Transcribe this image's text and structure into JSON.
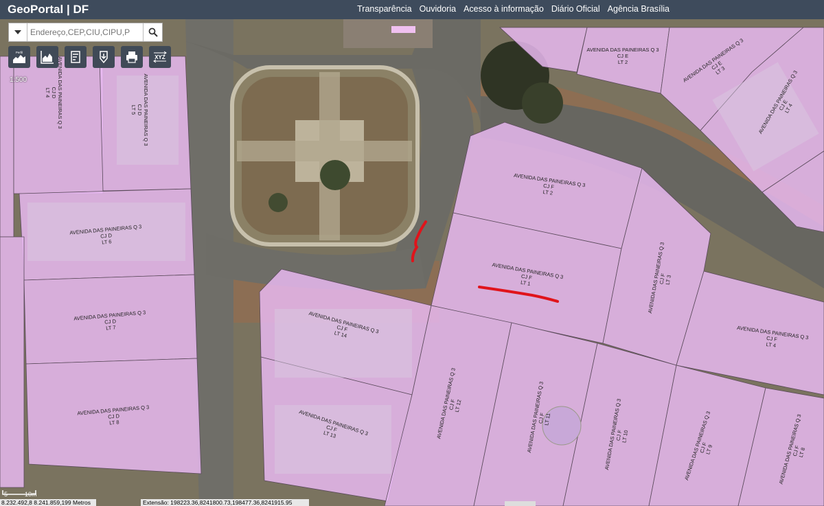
{
  "header": {
    "brand": "GeoPortal | DF",
    "nav": [
      "Transparência",
      "Ouvidoria",
      "Acesso à informação",
      "Diário Oficial",
      "Agência Brasília"
    ]
  },
  "search": {
    "placeholder": "Endereço,CEP,CIU,CIPU,P"
  },
  "toolbar": {
    "tools": [
      "profile-tool-icon",
      "elevation-chart-icon",
      "measure-tool-icon",
      "download-icon",
      "print-icon",
      "xyz-coordinates-icon"
    ],
    "profile_text": "Perfil",
    "xyz_text": "XYZ"
  },
  "map": {
    "scale": "1:500",
    "scalebar_left": "5",
    "scalebar_right": "10m",
    "coordinates": "8.232.492,8 8.241.859,199 Metros",
    "extent": "Extensão: 198223.36,8241800.73,198477.36,8241915.95",
    "lot_color": "#e7b7ef",
    "annotation_color": "#e0141b",
    "lots": [
      {
        "street": "AVENIDA DAS PAINEIRAS Q 3",
        "block": "CJ D",
        "lot": "LT 4"
      },
      {
        "street": "AVENIDA DAS PAINEIRAS Q 3",
        "block": "CJ D",
        "lot": "LT 5"
      },
      {
        "street": "AVENIDA DAS PAINEIRAS Q 3",
        "block": "CJ D",
        "lot": "LT 6"
      },
      {
        "street": "AVENIDA DAS PAINEIRAS Q 3",
        "block": "CJ D",
        "lot": "LT 7"
      },
      {
        "street": "AVENIDA DAS PAINEIRAS Q 3",
        "block": "CJ D",
        "lot": "LT 8"
      },
      {
        "street": "AVENIDA DAS PAINEIRAS Q 3",
        "block": "CJ E",
        "lot": "LT 2"
      },
      {
        "street": "AVENIDA DAS PAINEIRAS Q 3",
        "block": "CJ E",
        "lot": "LT 3"
      },
      {
        "street": "AVENIDA DAS PAINEIRAS Q 3",
        "block": "CJ E",
        "lot": "LT 4"
      },
      {
        "street": "AVENIDA DAS PAINEIRAS Q 3",
        "block": "CJ F",
        "lot": "LT 2"
      },
      {
        "street": "AVENIDA DAS PAINEIRAS Q 3",
        "block": "CJ F",
        "lot": "LT 1"
      },
      {
        "street": "AVENIDA DAS PAINEIRAS Q 3",
        "block": "CJ F",
        "lot": "LT 3"
      },
      {
        "street": "AVENIDA DAS PAINEIRAS Q 3",
        "block": "CJ F",
        "lot": "LT 4"
      },
      {
        "street": "AVENIDA DAS PAINEIRAS Q 3",
        "block": "CJ F",
        "lot": "LT 14"
      },
      {
        "street": "AVENIDA DAS PAINEIRAS Q 3",
        "block": "CJ F",
        "lot": "LT 13"
      },
      {
        "street": "AVENIDA DAS PAINEIRAS Q 3",
        "block": "CJ F",
        "lot": "LT 12"
      },
      {
        "street": "AVENIDA DAS PAINEIRAS Q 3",
        "block": "CJ F",
        "lot": "LT 11"
      },
      {
        "street": "AVENIDA DAS PAINEIRAS Q 3",
        "block": "CJ F",
        "lot": "LT 10"
      },
      {
        "street": "AVENIDA DAS PAINEIRAS Q 3",
        "block": "CJ F",
        "lot": "LT 9"
      },
      {
        "street": "AVENIDA DAS PAINEIRAS Q 3",
        "block": "CJ F",
        "lot": "LT 8"
      }
    ]
  }
}
